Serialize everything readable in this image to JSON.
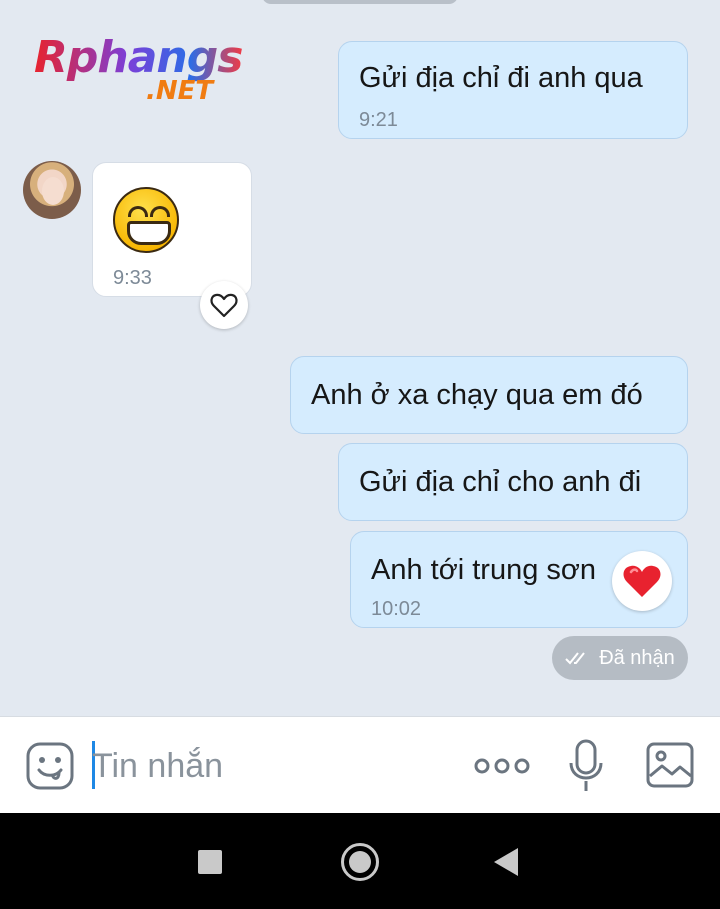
{
  "watermark": {
    "line1": "Rphangs",
    "line2": ".NET"
  },
  "messages": [
    {
      "direction": "out",
      "text": "Gửi địa chỉ đi anh qua",
      "time": "9:21"
    },
    {
      "direction": "in",
      "emoji": "grinning-face",
      "time": "9:33",
      "reaction": "heart-outline"
    },
    {
      "direction": "out",
      "text": "Anh ở xa chạy qua em đó"
    },
    {
      "direction": "out",
      "text": "Gửi địa chỉ cho anh đi"
    },
    {
      "direction": "out",
      "text": "Anh tới trung sơn",
      "time": "10:02",
      "reaction": "red-heart"
    }
  ],
  "status": {
    "label": "Đã nhận",
    "icon": "double-check-icon"
  },
  "composer": {
    "placeholder": "Tin nhắn",
    "icons": [
      "sticker-icon",
      "more-icon",
      "microphone-icon",
      "image-icon"
    ]
  },
  "nav": {
    "icons": [
      "recents-icon",
      "home-icon",
      "back-icon"
    ]
  },
  "colors": {
    "chat_background": "#e3e9f1",
    "outgoing_bubble": "#d5ecfe",
    "incoming_bubble": "#ffffff",
    "accent": "#1e88e5",
    "status_pill": "#b5bcc4"
  }
}
